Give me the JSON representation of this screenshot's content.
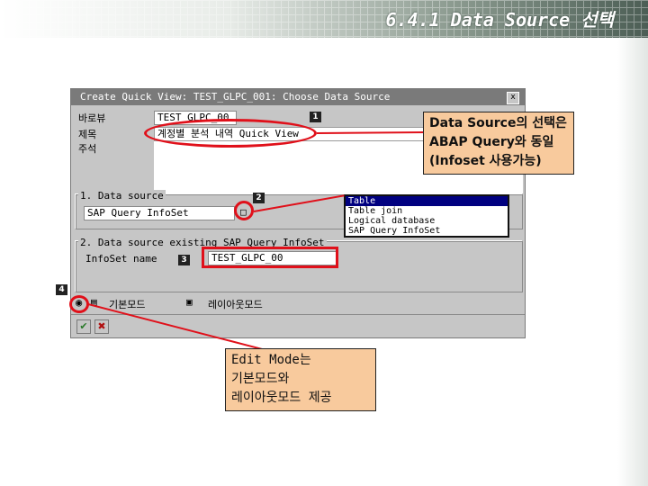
{
  "slide": {
    "title": "6.4.1 Data Source 선택"
  },
  "window": {
    "title": "Create Quick View: TEST_GLPC_001: Choose Data Source",
    "close_label": "x"
  },
  "fields": {
    "quickview_label": "바로뷰",
    "quickview_value": "TEST_GLPC_00",
    "title_label": "제목",
    "title_value": "계정별 분석 내역 Quick View",
    "notes_label": "주석"
  },
  "data_source_group": {
    "title": "1. Data source",
    "value": "SAP Query InfoSet",
    "dropdown_icon": "□"
  },
  "infoset_group": {
    "title": "2. Data source existing SAP Query InfoSet",
    "label": "InfoSet name",
    "value": "TEST_GLPC_00"
  },
  "dropdown": {
    "options": [
      "Table",
      "Table join",
      "Logical database",
      "SAP Query InfoSet"
    ],
    "selected_index": 0
  },
  "mode": {
    "basic_label": "기본모드",
    "layout_label": "레이아웃모드"
  },
  "badges": [
    "1",
    "2",
    "3",
    "4"
  ],
  "buttons": {
    "confirm": "✔",
    "cancel": "✖"
  },
  "callouts": {
    "data_source_lines": [
      "Data Source의 선택은",
      "ABAP Query와 동일",
      "(Infoset 사용가능)"
    ],
    "edit_mode_lines": [
      "Edit Mode는",
      "기본모드와",
      "레이아웃모드 제공"
    ]
  },
  "colors": {
    "highlight": "#e0101a",
    "callout_fill": "#f8ca9d",
    "sap_gray": "#c6c6c6",
    "selection": "#000080"
  }
}
